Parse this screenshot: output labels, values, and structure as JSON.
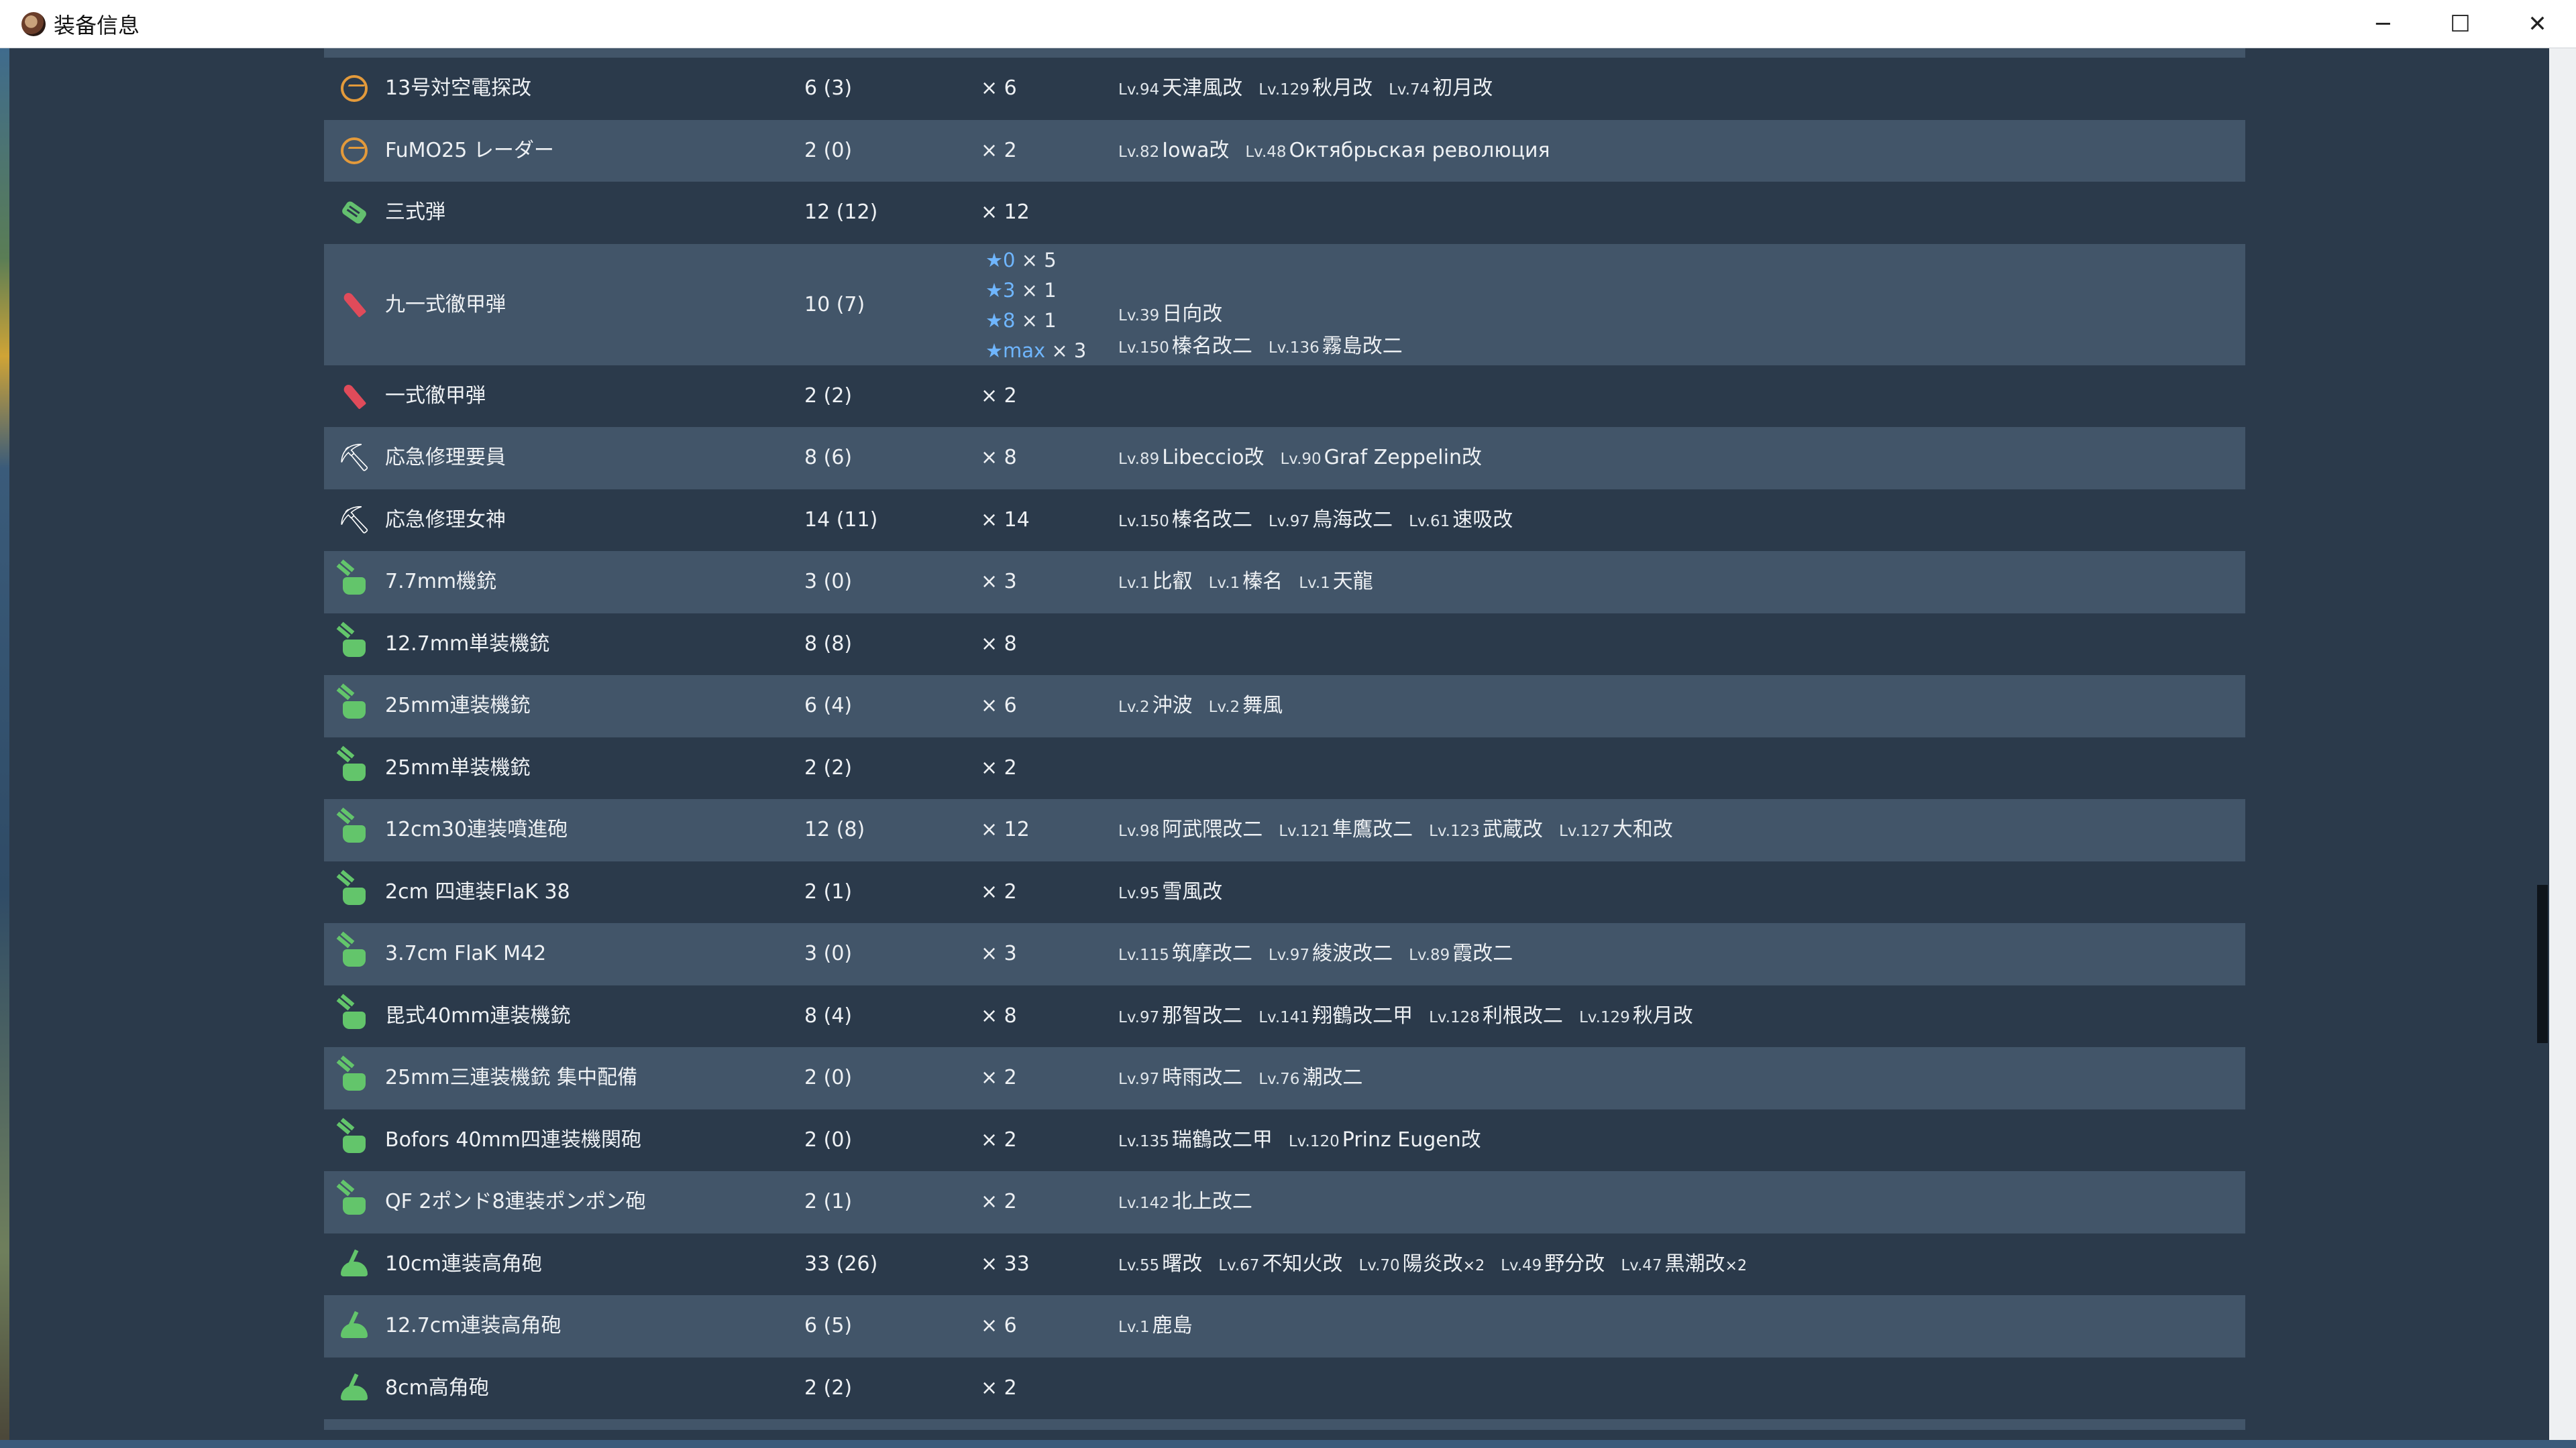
{
  "window": {
    "title": "装备信息",
    "minimize": "─",
    "maximize": "☐",
    "close": "✕"
  },
  "rows": [
    {
      "icon": "radar-icon",
      "name": "13号対空電探改",
      "count": "6 (3)",
      "mult": "× 6",
      "ships": [
        {
          "lv": "Lv.94",
          "name": "天津風改"
        },
        {
          "lv": "Lv.129",
          "name": "秋月改"
        },
        {
          "lv": "Lv.74",
          "name": "初月改"
        }
      ]
    },
    {
      "icon": "radar-icon",
      "name": "FuMO25 レーダー",
      "count": "2 (0)",
      "mult": "× 2",
      "ships": [
        {
          "lv": "Lv.82",
          "name": "Iowa改"
        },
        {
          "lv": "Lv.48",
          "name": "Октябрьская революция"
        }
      ]
    },
    {
      "icon": "type3-shell-icon",
      "name": "三式弾",
      "count": "12 (12)",
      "mult": "× 12",
      "ships": []
    },
    {
      "icon": "ap-shell-icon",
      "name": "九一式徹甲弾",
      "count": "10 (7)",
      "stars": [
        {
          "star": "★0",
          "rest": " × 5"
        },
        {
          "star": "★3",
          "rest": " × 1"
        },
        {
          "star": "★8",
          "rest": " × 1"
        },
        {
          "star": "★max",
          "rest": " × 3"
        }
      ],
      "ships_lines": [
        [
          {
            "lv": "Lv.39",
            "name": "日向改"
          }
        ],
        [
          {
            "lv": "Lv.150",
            "name": "榛名改二"
          },
          {
            "lv": "Lv.136",
            "name": "霧島改二"
          }
        ]
      ]
    },
    {
      "icon": "ap-shell-icon",
      "name": "一式徹甲弾",
      "count": "2 (2)",
      "mult": "× 2",
      "ships": []
    },
    {
      "icon": "repair-icon",
      "name": "応急修理要員",
      "count": "8 (6)",
      "mult": "× 8",
      "ships": [
        {
          "lv": "Lv.89",
          "name": "Libeccio改"
        },
        {
          "lv": "Lv.90",
          "name": "Graf Zeppelin改"
        }
      ]
    },
    {
      "icon": "repair-icon",
      "name": "応急修理女神",
      "count": "14 (11)",
      "mult": "× 14",
      "ships": [
        {
          "lv": "Lv.150",
          "name": "榛名改二"
        },
        {
          "lv": "Lv.97",
          "name": "鳥海改二"
        },
        {
          "lv": "Lv.61",
          "name": "速吸改"
        }
      ]
    },
    {
      "icon": "machine-gun-icon",
      "name": "7.7mm機銃",
      "count": "3 (0)",
      "mult": "× 3",
      "ships": [
        {
          "lv": "Lv.1",
          "name": "比叡"
        },
        {
          "lv": "Lv.1",
          "name": "榛名"
        },
        {
          "lv": "Lv.1",
          "name": "天龍"
        }
      ]
    },
    {
      "icon": "machine-gun-icon",
      "name": "12.7mm単装機銃",
      "count": "8 (8)",
      "mult": "× 8",
      "ships": []
    },
    {
      "icon": "machine-gun-icon",
      "name": "25mm連装機銃",
      "count": "6 (4)",
      "mult": "× 6",
      "ships": [
        {
          "lv": "Lv.2",
          "name": "沖波"
        },
        {
          "lv": "Lv.2",
          "name": "舞風"
        }
      ]
    },
    {
      "icon": "machine-gun-icon",
      "name": "25mm単装機銃",
      "count": "2 (2)",
      "mult": "× 2",
      "ships": []
    },
    {
      "icon": "machine-gun-icon",
      "name": "12cm30連装噴進砲",
      "count": "12 (8)",
      "mult": "× 12",
      "ships": [
        {
          "lv": "Lv.98",
          "name": "阿武隈改二"
        },
        {
          "lv": "Lv.121",
          "name": "隼鷹改二"
        },
        {
          "lv": "Lv.123",
          "name": "武蔵改"
        },
        {
          "lv": "Lv.127",
          "name": "大和改"
        }
      ]
    },
    {
      "icon": "machine-gun-icon",
      "name": "2cm 四連装FlaK 38",
      "count": "2 (1)",
      "mult": "× 2",
      "ships": [
        {
          "lv": "Lv.95",
          "name": "雪風改"
        }
      ]
    },
    {
      "icon": "machine-gun-icon",
      "name": "3.7cm FlaK M42",
      "count": "3 (0)",
      "mult": "× 3",
      "ships": [
        {
          "lv": "Lv.115",
          "name": "筑摩改二"
        },
        {
          "lv": "Lv.97",
          "name": "綾波改二"
        },
        {
          "lv": "Lv.89",
          "name": "霞改二"
        }
      ]
    },
    {
      "icon": "machine-gun-icon",
      "name": "毘式40mm連装機銃",
      "count": "8 (4)",
      "mult": "× 8",
      "ships": [
        {
          "lv": "Lv.97",
          "name": "那智改二"
        },
        {
          "lv": "Lv.141",
          "name": "翔鶴改二甲"
        },
        {
          "lv": "Lv.128",
          "name": "利根改二"
        },
        {
          "lv": "Lv.129",
          "name": "秋月改"
        }
      ]
    },
    {
      "icon": "machine-gun-icon",
      "name": "25mm三連装機銃 集中配備",
      "count": "2 (0)",
      "mult": "× 2",
      "ships": [
        {
          "lv": "Lv.97",
          "name": "時雨改二"
        },
        {
          "lv": "Lv.76",
          "name": "潮改二"
        }
      ]
    },
    {
      "icon": "machine-gun-icon",
      "name": "Bofors 40mm四連装機関砲",
      "count": "2 (0)",
      "mult": "× 2",
      "ships": [
        {
          "lv": "Lv.135",
          "name": "瑞鶴改二甲"
        },
        {
          "lv": "Lv.120",
          "name": "Prinz Eugen改"
        }
      ]
    },
    {
      "icon": "machine-gun-icon",
      "name": "QF 2ポンド8連装ポンポン砲",
      "count": "2 (1)",
      "mult": "× 2",
      "ships": [
        {
          "lv": "Lv.142",
          "name": "北上改二"
        }
      ]
    },
    {
      "icon": "aa-gun-icon",
      "name": "10cm連装高角砲",
      "count": "33 (26)",
      "mult": "× 33",
      "ships": [
        {
          "lv": "Lv.55",
          "name": "曙改"
        },
        {
          "lv": "Lv.67",
          "name": "不知火改"
        },
        {
          "lv": "Lv.70",
          "name": "陽炎改",
          "extra": "×2"
        },
        {
          "lv": "Lv.49",
          "name": "野分改"
        },
        {
          "lv": "Lv.47",
          "name": "黒潮改",
          "extra": "×2"
        }
      ]
    },
    {
      "icon": "aa-gun-icon",
      "name": "12.7cm連装高角砲",
      "count": "6 (5)",
      "mult": "× 6",
      "ships": [
        {
          "lv": "Lv.1",
          "name": "鹿島"
        }
      ]
    },
    {
      "icon": "aa-gun-icon",
      "name": "8cm高角砲",
      "count": "2 (2)",
      "mult": "× 2",
      "ships": []
    }
  ]
}
